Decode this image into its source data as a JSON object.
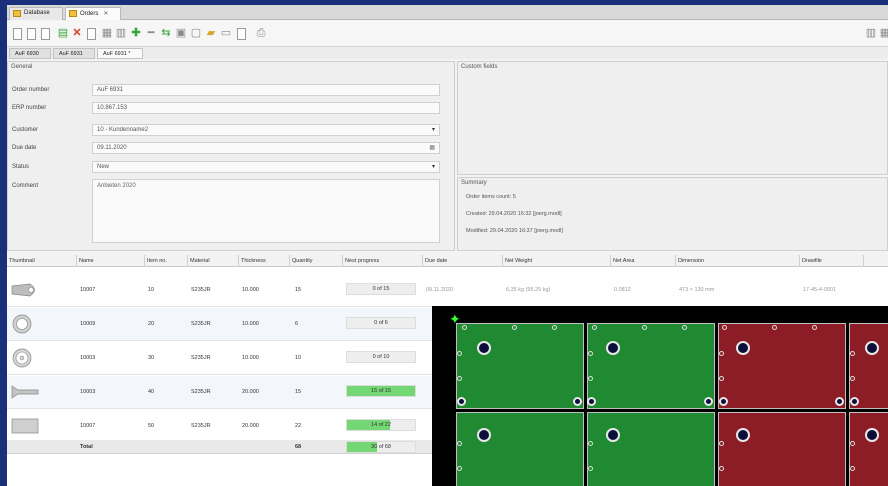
{
  "tabs": [
    {
      "label": "Database"
    },
    {
      "label": "Orders"
    }
  ],
  "subtabs": [
    {
      "label": "AuF 6930"
    },
    {
      "label": "AuF 6931"
    },
    {
      "label": "AuF 6931 *"
    }
  ],
  "general": {
    "title": "General",
    "fields": [
      {
        "label": "Order number",
        "value": "AuF 6931"
      },
      {
        "label": "ERP number",
        "value": "10.867.153"
      },
      {
        "label": "Customer",
        "value": "10 - Kundenname2"
      },
      {
        "label": "Due date",
        "value": "09.11.2020"
      },
      {
        "label": "Status",
        "value": "New"
      },
      {
        "label": "Comment",
        "value": "Anbieten 2020"
      }
    ]
  },
  "custom_fields": {
    "title": "Custom fields"
  },
  "summary": {
    "title": "Summary",
    "lines": [
      "Order items count: 5",
      "Created: 29.04.2020 16:32 [joerg.modl]",
      "Modified: 29.04.2020 16:37 [joerg.modl]"
    ]
  },
  "grid": {
    "columns": [
      "Thumbnail",
      "Name",
      "Item no.",
      "Material",
      "Thickness",
      "Quantity",
      "Nest progress",
      "Due date",
      "Net Weight",
      "Net Area",
      "Dimension",
      "Drawfile"
    ],
    "rows": [
      {
        "name": "10007",
        "item": "10",
        "material": "S235JR",
        "thickness": "10.000",
        "quantity": "15",
        "progress": "0 of 15",
        "progress_frac": 0.0,
        "due": "09.11.2020",
        "weight": "6,35 kg (95,25 kg)",
        "area": "0.0812",
        "dimension": "473 × 130 mm",
        "drawfile": "17-45-4-0001"
      },
      {
        "name": "10009",
        "item": "20",
        "material": "S235JR",
        "thickness": "10.000",
        "quantity": "6",
        "progress": "0 of 6",
        "progress_frac": 0.0,
        "due": "",
        "weight": "",
        "area": "",
        "dimension": "",
        "drawfile": ""
      },
      {
        "name": "10003",
        "item": "30",
        "material": "S235JR",
        "thickness": "10.000",
        "quantity": "10",
        "progress": "0 of 10",
        "progress_frac": 0.0,
        "due": "",
        "weight": "",
        "area": "",
        "dimension": "",
        "drawfile": ""
      },
      {
        "name": "10003",
        "item": "40",
        "material": "S235JR",
        "thickness": "20.000",
        "quantity": "15",
        "progress": "15 of 15",
        "progress_frac": 1.0,
        "due": "",
        "weight": "",
        "area": "",
        "dimension": "",
        "drawfile": ""
      },
      {
        "name": "10007",
        "item": "50",
        "material": "S235JR",
        "thickness": "20.000",
        "quantity": "22",
        "progress": "14 of 22",
        "progress_frac": 0.636,
        "due": "",
        "weight": "",
        "area": "",
        "dimension": "",
        "drawfile": ""
      }
    ],
    "total": {
      "label": "Total",
      "quantity": "68",
      "progress": "30 of 68",
      "progress_frac": 0.44
    }
  },
  "icons": [
    "new-doc-icon",
    "open-icon",
    "save-icon",
    "print-icon",
    "delete-icon",
    "add-icon",
    "move-icon",
    "folder-icon",
    "layout-icon"
  ],
  "colors": {
    "accent_green": "#1f8a32",
    "accent_red": "#8c1d26",
    "progress_green": "#73d773"
  }
}
